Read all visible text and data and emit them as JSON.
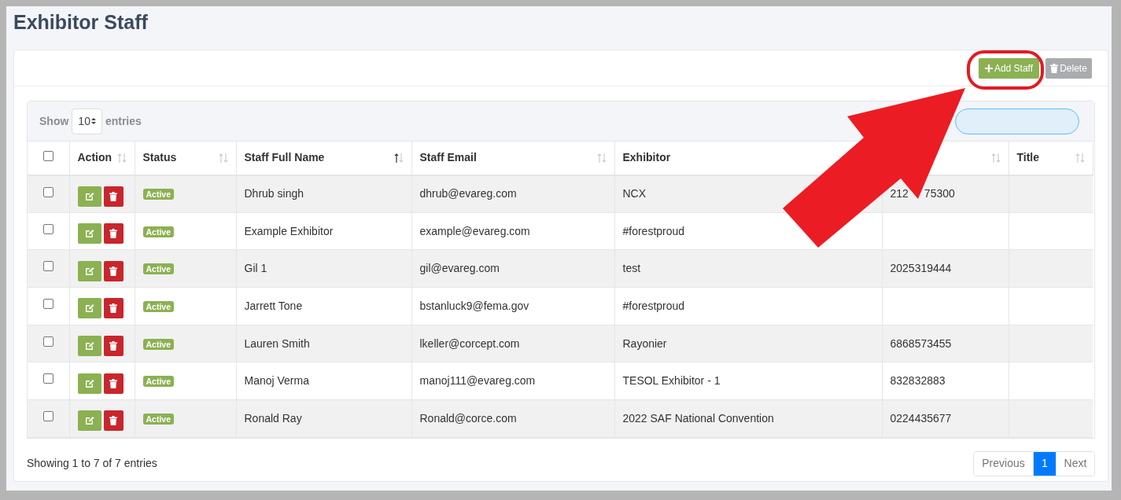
{
  "page_title": "Exhibitor Staff",
  "toolbar_buttons": [
    {
      "kind": "add",
      "label": "Add Staff"
    },
    {
      "kind": "delete",
      "label": "Delete"
    }
  ],
  "length_menu": {
    "prefix": "Show",
    "value": "10",
    "suffix": "entries"
  },
  "select_all": {
    "checked": false
  },
  "columns": [
    {
      "label": "Action",
      "sorted": false
    },
    {
      "label": "Status",
      "sorted": false
    },
    {
      "label": "Staff Full Name",
      "sorted": true
    },
    {
      "label": "Staff Email",
      "sorted": false
    },
    {
      "label": "Exhibitor"
    },
    {
      "sorted": false
    },
    {
      "label": "Title",
      "sorted": false
    }
  ],
  "rows": [
    {
      "checked": false,
      "status": "Active",
      "name": "Dhrub singh",
      "email": "dhrub@evareg.com",
      "exhibitor": "NCX",
      "column_7_parts": [
        "212",
        "75300"
      ]
    },
    {
      "checked": false,
      "status": "Active",
      "name": "Example Exhibitor",
      "email": "example@evareg.com",
      "exhibitor": "#forestproud"
    },
    {
      "checked": false,
      "status": "Active",
      "name": "Gil 1",
      "email": "gil@evareg.com",
      "exhibitor": "test",
      "column_7_parts": [
        "2025319444"
      ]
    },
    {
      "checked": false,
      "status": "Active",
      "name": "Jarrett Tone",
      "email": "bstanluck9@fema.gov",
      "exhibitor": "#forestproud"
    },
    {
      "checked": false,
      "status": "Active",
      "name": "Lauren Smith",
      "email": "lkeller@corcept.com",
      "exhibitor": "Rayonier",
      "column_7_parts": [
        "6868573455"
      ]
    },
    {
      "checked": false,
      "status": "Active",
      "name": "Manoj Verma",
      "email": "manoj111@evareg.com",
      "exhibitor": "TESOL Exhibitor - 1",
      "column_7_parts": [
        "832832883"
      ]
    },
    {
      "checked": false,
      "status": "Active",
      "name": "Ronald Ray",
      "email": "Ronald@corce.com",
      "exhibitor": "2022 SAF National Convention",
      "column_7_parts": [
        "0224435677"
      ]
    }
  ],
  "info": "Showing 1 to 7 of 7 entries",
  "pagination": [
    {
      "kind": "prev",
      "label": "Previous",
      "selected": false
    },
    {
      "kind": "page",
      "label": "1",
      "selected": true
    },
    {
      "kind": "next",
      "label": "Next",
      "selected": false
    }
  ]
}
